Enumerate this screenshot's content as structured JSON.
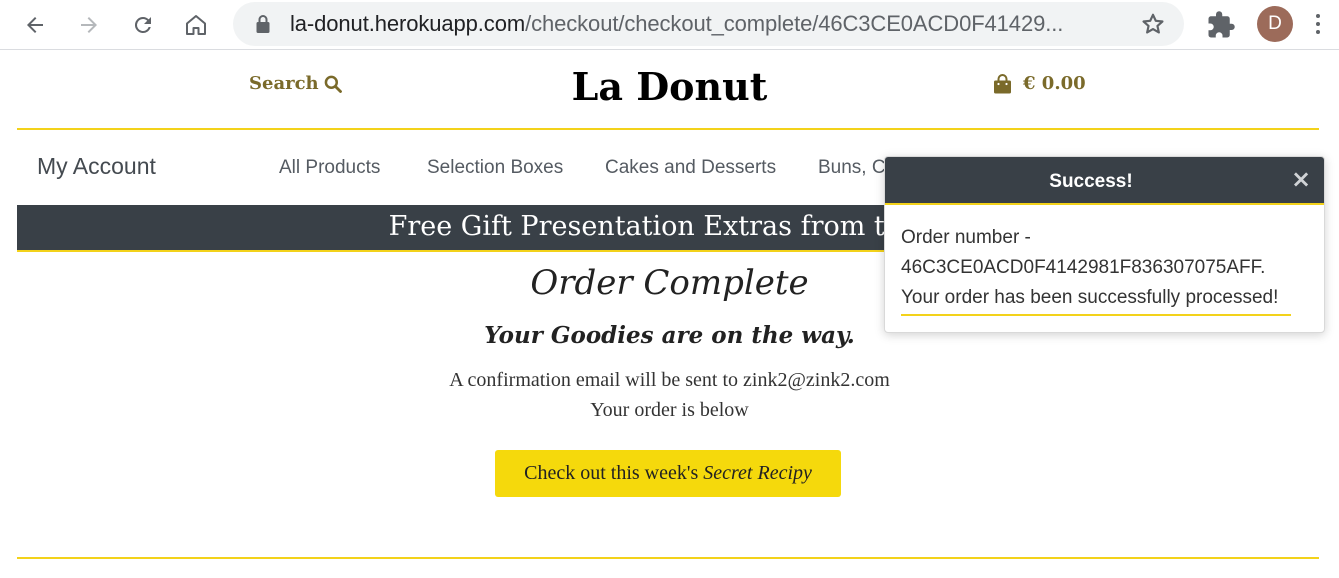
{
  "browser": {
    "url_host": "la-donut.herokuapp.com",
    "url_path": "/checkout/checkout_complete/46C3CE0ACD0F41429...",
    "profile_initial": "D",
    "icons": [
      "back-icon",
      "forward-icon",
      "reload-icon",
      "home-icon",
      "lock-icon",
      "star-icon",
      "extensions-icon",
      "menu-icon"
    ]
  },
  "header": {
    "search_label": "Search",
    "brand": "La Donut",
    "cart_total": "€ 0.00"
  },
  "nav": {
    "my_account": "My Account",
    "items": [
      "All Products",
      "Selection Boxes",
      "Cakes and Desserts",
      "Buns, C"
    ]
  },
  "banner": {
    "text": "Free Gift Presentation Extras from the C"
  },
  "order": {
    "title": "Order Complete",
    "subtitle": "Your Goodies are on the way.",
    "email_line": "A confirmation email will be sent to zink2@zink2.com",
    "below_line": "Your order is below",
    "button_prefix": "Check out this week's",
    "button_italic": "Secret Recipy"
  },
  "toast": {
    "title": "Success!",
    "close_symbol": "×",
    "line1": "Order number -",
    "line2": "46C3CE0ACD0F4142981F836307075AFF.",
    "line3": "Your order has been successfully processed!"
  },
  "colors": {
    "accent_yellow": "#f3d21a",
    "button_yellow": "#f5d90c",
    "dark_slate": "#394047",
    "gold_text": "#7a6a2a"
  }
}
